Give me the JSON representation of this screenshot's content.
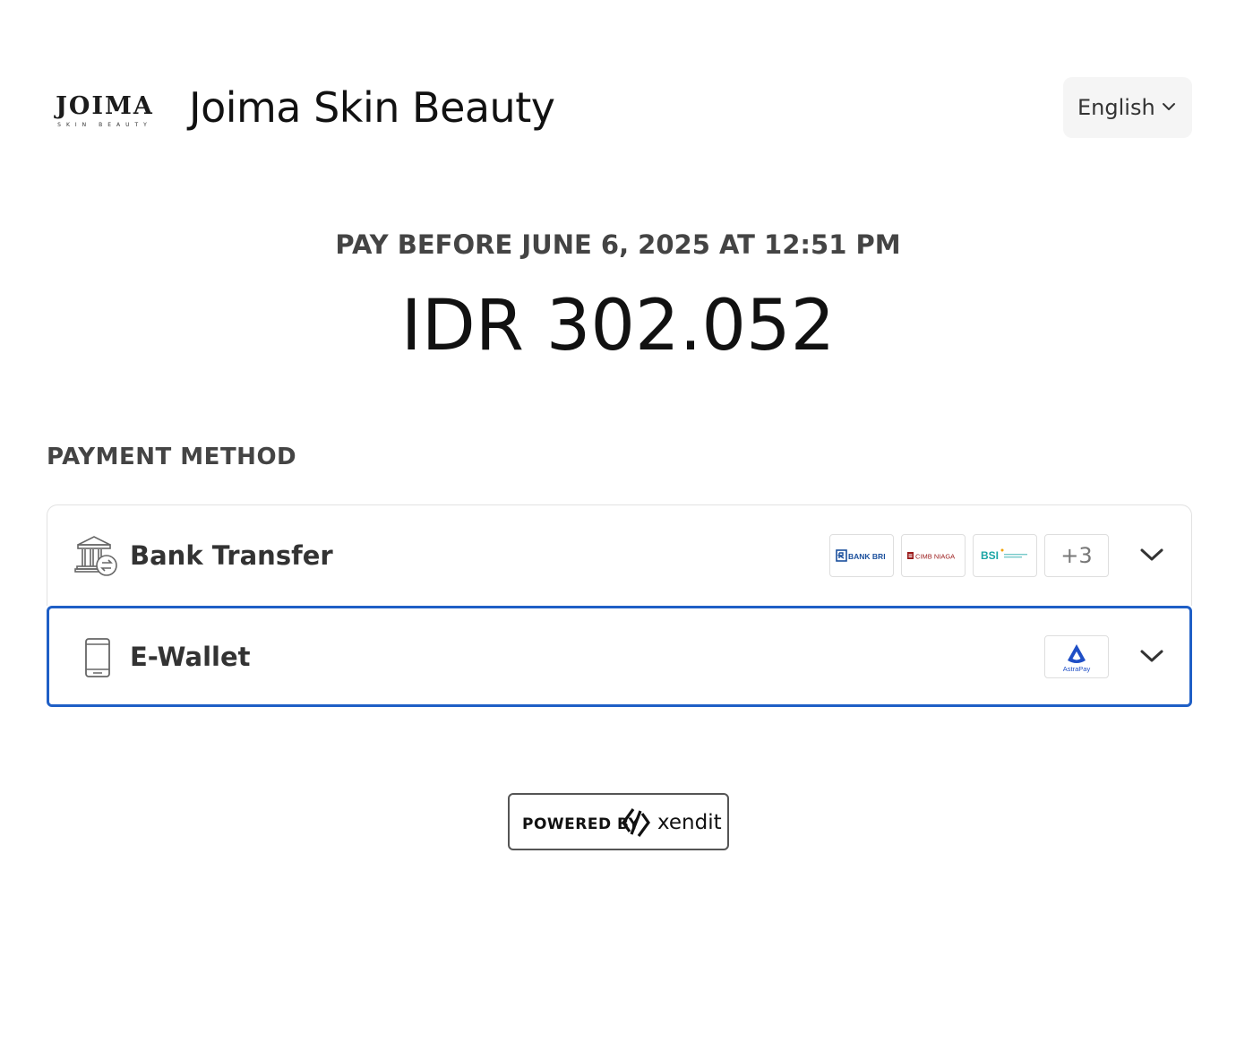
{
  "header": {
    "logo": {
      "word": "JOIMA",
      "sub": "SKIN BEAUTY"
    },
    "merchant_name": "Joima Skin Beauty",
    "language": {
      "selected": "English",
      "icon": "chevron-down-icon"
    }
  },
  "invoice": {
    "deadline": "PAY BEFORE JUNE 6, 2025 AT 12:51 PM",
    "amount": "IDR 302.052"
  },
  "payment": {
    "section_title": "PAYMENT METHOD",
    "methods": [
      {
        "label": "Bank Transfer",
        "icon": "bank-transfer-icon",
        "logos": [
          "BANK BRI",
          "CIMB NIAGA",
          "BSI"
        ],
        "more": "+3",
        "expanded": false,
        "selected": false
      },
      {
        "label": "E-Wallet",
        "icon": "mobile-phone-icon",
        "logos": [
          "AstraPay"
        ],
        "expanded": false,
        "selected": true
      }
    ]
  },
  "footer": {
    "powered_by": "POWERED BY",
    "brand": "xendit"
  },
  "colors": {
    "accent_selected_border": "#1f5fc6",
    "bri_blue": "#1a4f9c",
    "cimb_red": "#9b1b1b",
    "bsi_teal": "#1ba5a5",
    "astrapay_blue": "#1f4fc6"
  }
}
